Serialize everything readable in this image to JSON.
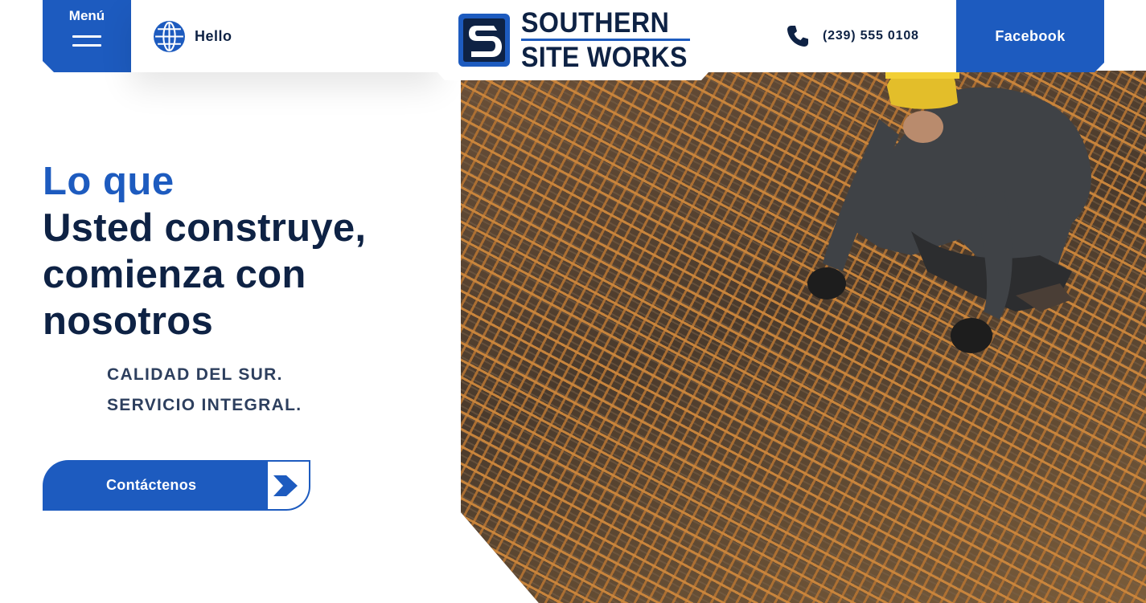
{
  "header": {
    "menu_label": "Menú",
    "greeting": "Hello",
    "logo": {
      "line1": "SOUTHERN",
      "line2": "SITE WORKS",
      "mark_letter": "S"
    },
    "phone": "(239) 555 0108",
    "social_label": "Facebook"
  },
  "hero": {
    "headline_accent": "Lo que",
    "headline_main": "Usted construye, comienza con nosotros",
    "tagline_line1": "CALIDAD DEL SUR.",
    "tagline_line2": "SERVICIO INTEGRAL.",
    "cta_label": "Contáctenos"
  },
  "icons": {
    "menu": "hamburger-icon",
    "language": "globe-icon",
    "phone": "phone-icon",
    "cta": "chevron-right-icon"
  },
  "colors": {
    "brand_blue": "#1d5bbf",
    "navy": "#0e2244",
    "tagline": "#2d3f5e",
    "background": "#ffffff"
  }
}
